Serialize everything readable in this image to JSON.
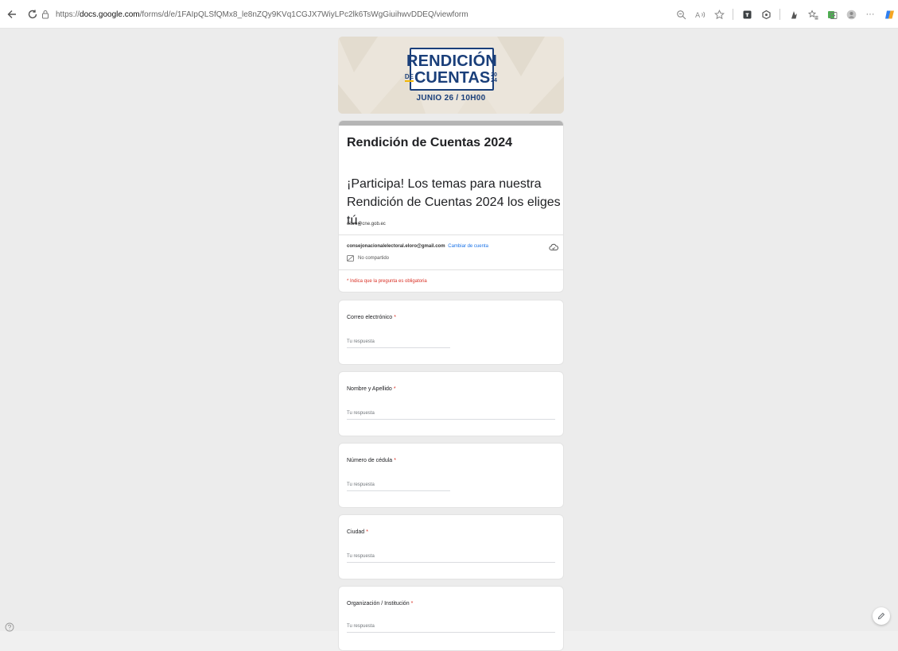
{
  "browser": {
    "url_prefix": "https://",
    "url_host": "docs.google.com",
    "url_rest": "/forms/d/e/1FAIpQLSfQMx8_le8nZQy9KVq1CGJX7WiyLPc2lk6TsWgGiuihwvDDEQ/viewform",
    "toolbar_icons": [
      "zoom-icon",
      "read-aloud-icon",
      "favorite-icon",
      "extension-icon",
      "extension-icon-2",
      "extension-icon-3",
      "favorites-icon",
      "collections-icon",
      "profile-icon",
      "more-icon",
      "copilot-icon"
    ],
    "more_label": "···"
  },
  "banner": {
    "logo_line1": "RENDICIÓN",
    "logo_de": "DE",
    "logo_line2": "CUENTAS",
    "logo_year_top": "20",
    "logo_year_bottom": "24",
    "date_text": "JUNIO 26 / 10H00"
  },
  "form": {
    "title": "Rendición de Cuentas 2024",
    "description": "¡Participa! Los temas para nuestra Rendición de Cuentas 2024 los eliges tú.",
    "owner_email": "eloro@cne.gob.ec",
    "account_email": "consejonacionalelectoral.eloro@gmail.com",
    "switch_account": "Cambiar de cuenta",
    "not_shared": "No compartido",
    "required_note": "* Indica que la pregunta es obligatoria"
  },
  "questions": [
    {
      "label": "Correo electrónico",
      "required": "*",
      "placeholder": "Tu respuesta"
    },
    {
      "label": "Nombre y Apellido",
      "required": "*",
      "placeholder": "Tu respuesta"
    },
    {
      "label": "Número de cédula",
      "required": "*",
      "placeholder": "Tu respuesta"
    },
    {
      "label": "Ciudad",
      "required": "*",
      "placeholder": "Tu respuesta"
    },
    {
      "label": "Organización / Institución",
      "required": "*",
      "placeholder": "Tu respuesta"
    }
  ],
  "colors": {
    "accent": "#1a73e8",
    "required": "#d93025",
    "brand_blue": "#1a3f7a",
    "brand_yellow": "#f2b705"
  }
}
